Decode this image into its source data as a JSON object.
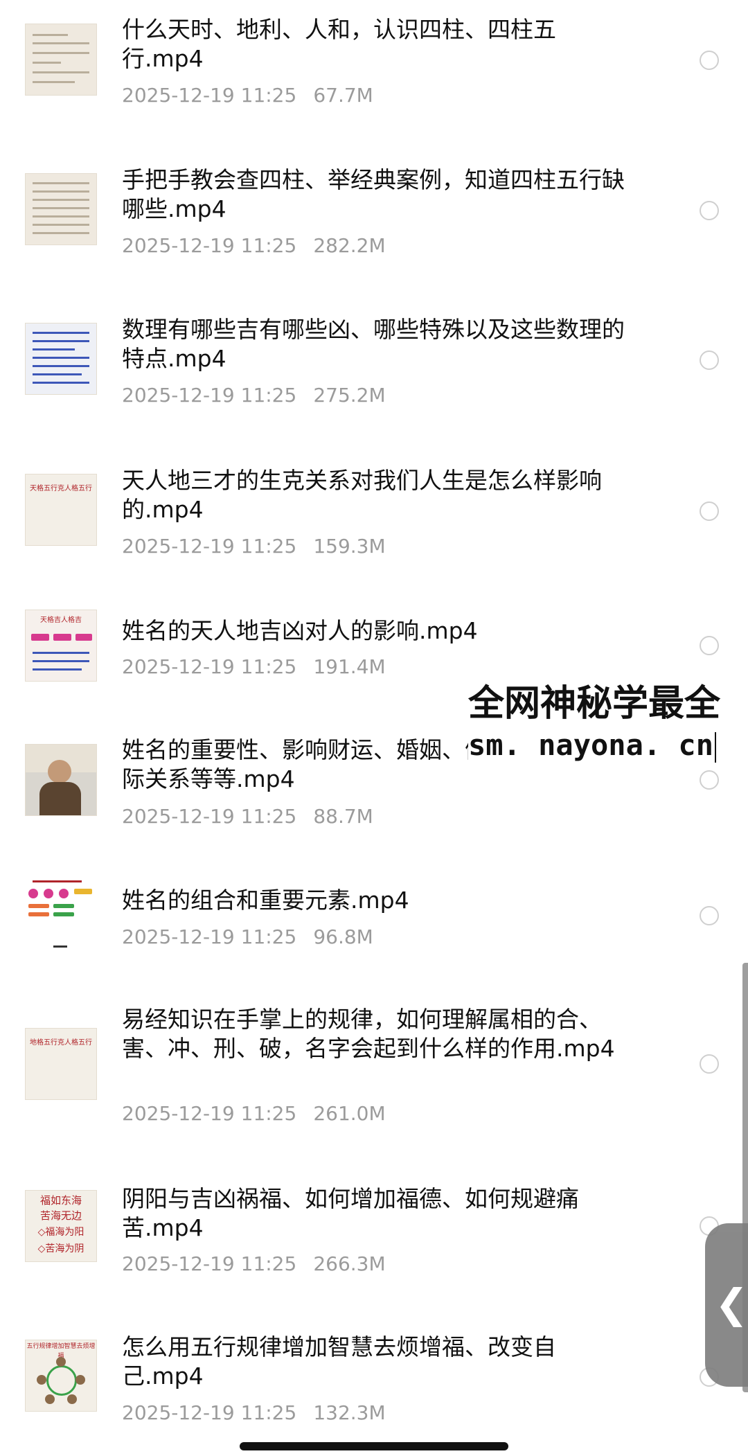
{
  "files": [
    {
      "title": "什么天时、地利、人和，认识四柱、四柱五行.mp4",
      "date": "2025-12-19 11:25",
      "size": "67.7M",
      "thumb": "chart-doc"
    },
    {
      "title": "手把手教会查四柱、举经典案例，知道四柱五行缺哪些.mp4",
      "date": "2025-12-19 11:25",
      "size": "282.2M",
      "thumb": "table-doc"
    },
    {
      "title": "数理有哪些吉有哪些凶、哪些特殊以及这些数理的特点.mp4",
      "date": "2025-12-19 11:25",
      "size": "275.2M",
      "thumb": "blue-text-doc"
    },
    {
      "title": "天人地三才的生克关系对我们人生是怎么样影响的.mp4",
      "date": "2025-12-19 11:25",
      "size": "159.3M",
      "thumb": "title-slide"
    },
    {
      "title": "姓名的天人地吉凶对人的影响.mp4",
      "date": "2025-12-19 11:25",
      "size": "191.4M",
      "thumb": "pink-diagram"
    },
    {
      "title": "姓名的重要性、影响财运、婚姻、健康，子女，人际关系等等.mp4",
      "date": "2025-12-19 11:25",
      "size": "88.7M",
      "thumb": "presenter-photo"
    },
    {
      "title": "姓名的组合和重要元素.mp4",
      "date": "2025-12-19 11:25",
      "size": "96.8M",
      "thumb": "flowchart"
    },
    {
      "title": "易经知识在手掌上的规律，如何理解属相的合、害、冲、刑、破，名字会起到什么样的作用.mp4",
      "date": "2025-12-19 11:25",
      "size": "261.0M",
      "thumb": "title-slide"
    },
    {
      "title": "阴阳与吉凶祸福、如何增加福德、如何规避痛苦.mp4",
      "date": "2025-12-19 11:25",
      "size": "266.3M",
      "thumb": "calligraphy-slide"
    },
    {
      "title": "怎么用五行规律增加智慧去烦增福、改变自己.mp4",
      "date": "2025-12-19 11:25",
      "size": "132.3M",
      "thumb": "circle-diagram"
    }
  ],
  "thumb_text": {
    "slide4": "天格五行克人格五行",
    "slide5": "天格吉人格吉",
    "slide8": "地格五行克人格五行",
    "slide9_l1": "福如东海",
    "slide9_l2": "苦海无边",
    "slide9_l3": "◇福海为阳",
    "slide9_l4": "◇苦海为阴",
    "slide10": "五行规律增加智慧去烦增福"
  },
  "watermark": {
    "line1": "全网神秘学最全",
    "line2": "sm. nayona. cn"
  },
  "side_handle": {
    "icon": "chevron-left-icon",
    "glyph": "❮"
  }
}
